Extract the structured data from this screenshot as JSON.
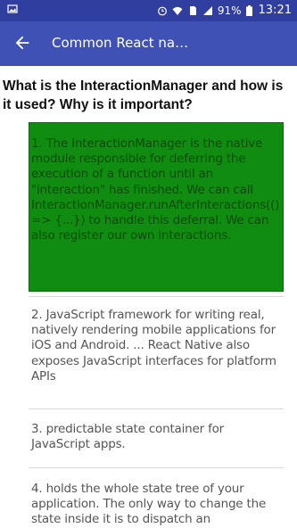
{
  "status_bar": {
    "battery_percent": "91%",
    "time": "13:21"
  },
  "app_bar": {
    "title": "Common React na…"
  },
  "question": "What is the InteractionManager and how is it used? Why is it important?",
  "answers": [
    {
      "text": "1. The InteractionManager is the native module responsible for deferring the execution of a function until an \"interaction\" has finished. We can call InteractionManager.runAfterInteractions(() => {...}) to handle this deferral. We can also register our own interactions.",
      "selected": true
    },
    {
      "text": "2. JavaScript framework for writing real, natively rendering mobile applications for iOS and Android. ... React Native also exposes JavaScript interfaces for platform APIs",
      "selected": false
    },
    {
      "text": "3. predictable state container for JavaScript apps.",
      "selected": false
    },
    {
      "text": "4. holds the whole state tree of your application. The only way to change the state inside it is to dispatch an",
      "selected": false
    }
  ],
  "colors": {
    "status_bar": "#303f9f",
    "app_bar": "#3f51b5",
    "selected_answer_bg": "#108c10",
    "selected_answer_text": "#0a4a0a"
  }
}
